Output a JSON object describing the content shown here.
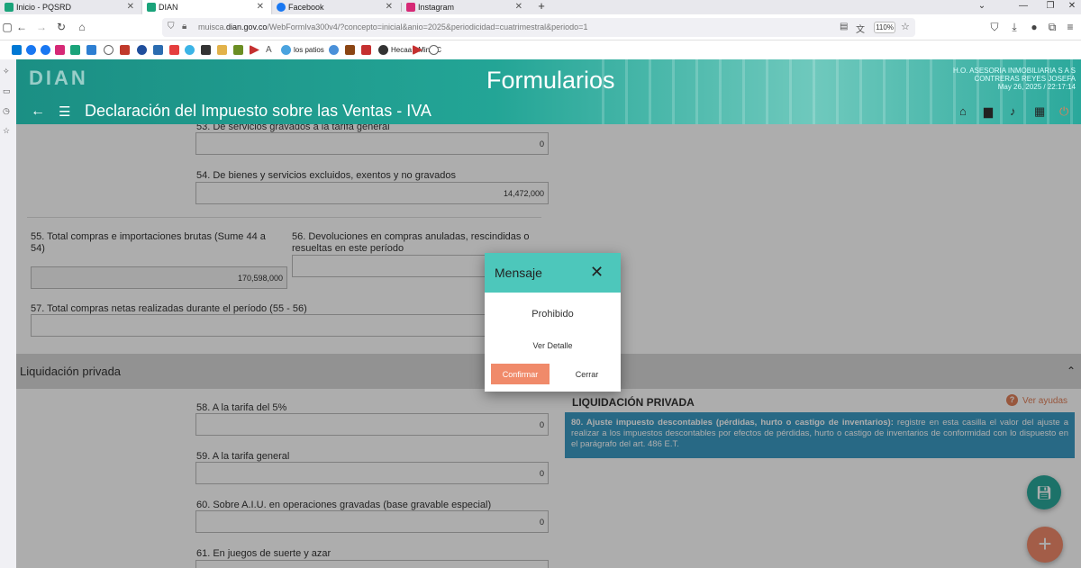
{
  "browser": {
    "tabs": [
      {
        "label": "Inicio - PQSRD",
        "color": "#1aa37a"
      },
      {
        "label": "DIAN",
        "color": "#1aa37a"
      },
      {
        "label": "Facebook",
        "color": "#1877f2"
      },
      {
        "label": "Instagram",
        "color": "#d62976"
      }
    ],
    "new_tab": "+",
    "url_prefix": "muisca.",
    "url_domain": "dian.gov.co",
    "url_rest": "/WebFormIva300v4/?concepto=inicial&anio=2025&periodicidad=cuatrimestral&periodo=1",
    "zoom": "110%",
    "bookmark_labels": {
      "patios": "los patios",
      "hecaa": "Hecaa - MinTIC"
    }
  },
  "header": {
    "logo": "DIAN",
    "title": "Formularios",
    "company": "H.O. ASESORIA INMOBILIARIA S A S",
    "user": "CONTRERAS REYES JOSEFA",
    "datetime": "May 26, 2025 / 22:17:14",
    "form_title": "Declaración del Impuesto sobre las Ventas - IVA"
  },
  "fields": {
    "f53": {
      "label": "53. De servicios gravados a la tarifa general",
      "value": "0"
    },
    "f54": {
      "label": "54. De bienes y servicios excluidos, exentos y no gravados",
      "value": "14,472,000"
    },
    "f55": {
      "label": "55. Total compras e importaciones brutas (Sume 44 a 54)",
      "value": "170,598,000"
    },
    "f56": {
      "label": "56. Devoluciones en compras anuladas, rescindidas o resueltas en este período",
      "value": ""
    },
    "f57": {
      "label": "57. Total compras netas realizadas durante el período (55 - 56)",
      "value": ""
    },
    "f58": {
      "label": "58. A la tarifa del 5%",
      "value": "0"
    },
    "f59": {
      "label": "59. A la tarifa general",
      "value": "0"
    },
    "f60": {
      "label": "60. Sobre A.I.U. en operaciones gravadas (base gravable especial)",
      "value": "0"
    },
    "f61": {
      "label": "61. En juegos de suerte y azar",
      "value": ""
    }
  },
  "section": {
    "title": "Liquidación privada"
  },
  "help": {
    "title": "LIQUIDACIÓN PRIVADA",
    "ver_ayudas": "Ver ayudas",
    "bold_text": "80. Ajuste impuesto descontables (pérdidas, hurto o castigo de inventarios):",
    "text": " registre en esta casilla el valor del ajuste a realizar a los impuestos descontables por efectos de pérdidas, hurto o castigo de inventarios de conformidad con lo dispuesto en el parágrafo del art. 486 E.T."
  },
  "modal": {
    "title": "Mensaje",
    "message": "Prohibido",
    "detail": "Ver Detalle",
    "confirm_label": "Confirmar",
    "close_label": "Cerrar"
  },
  "colors": {
    "header": "#23a596",
    "modal_header": "#4dc7bb",
    "confirm": "#f08a6a",
    "help_box": "#3b9bc5",
    "fab_save": "#2aa89b",
    "fab_add": "#f08a6a"
  }
}
